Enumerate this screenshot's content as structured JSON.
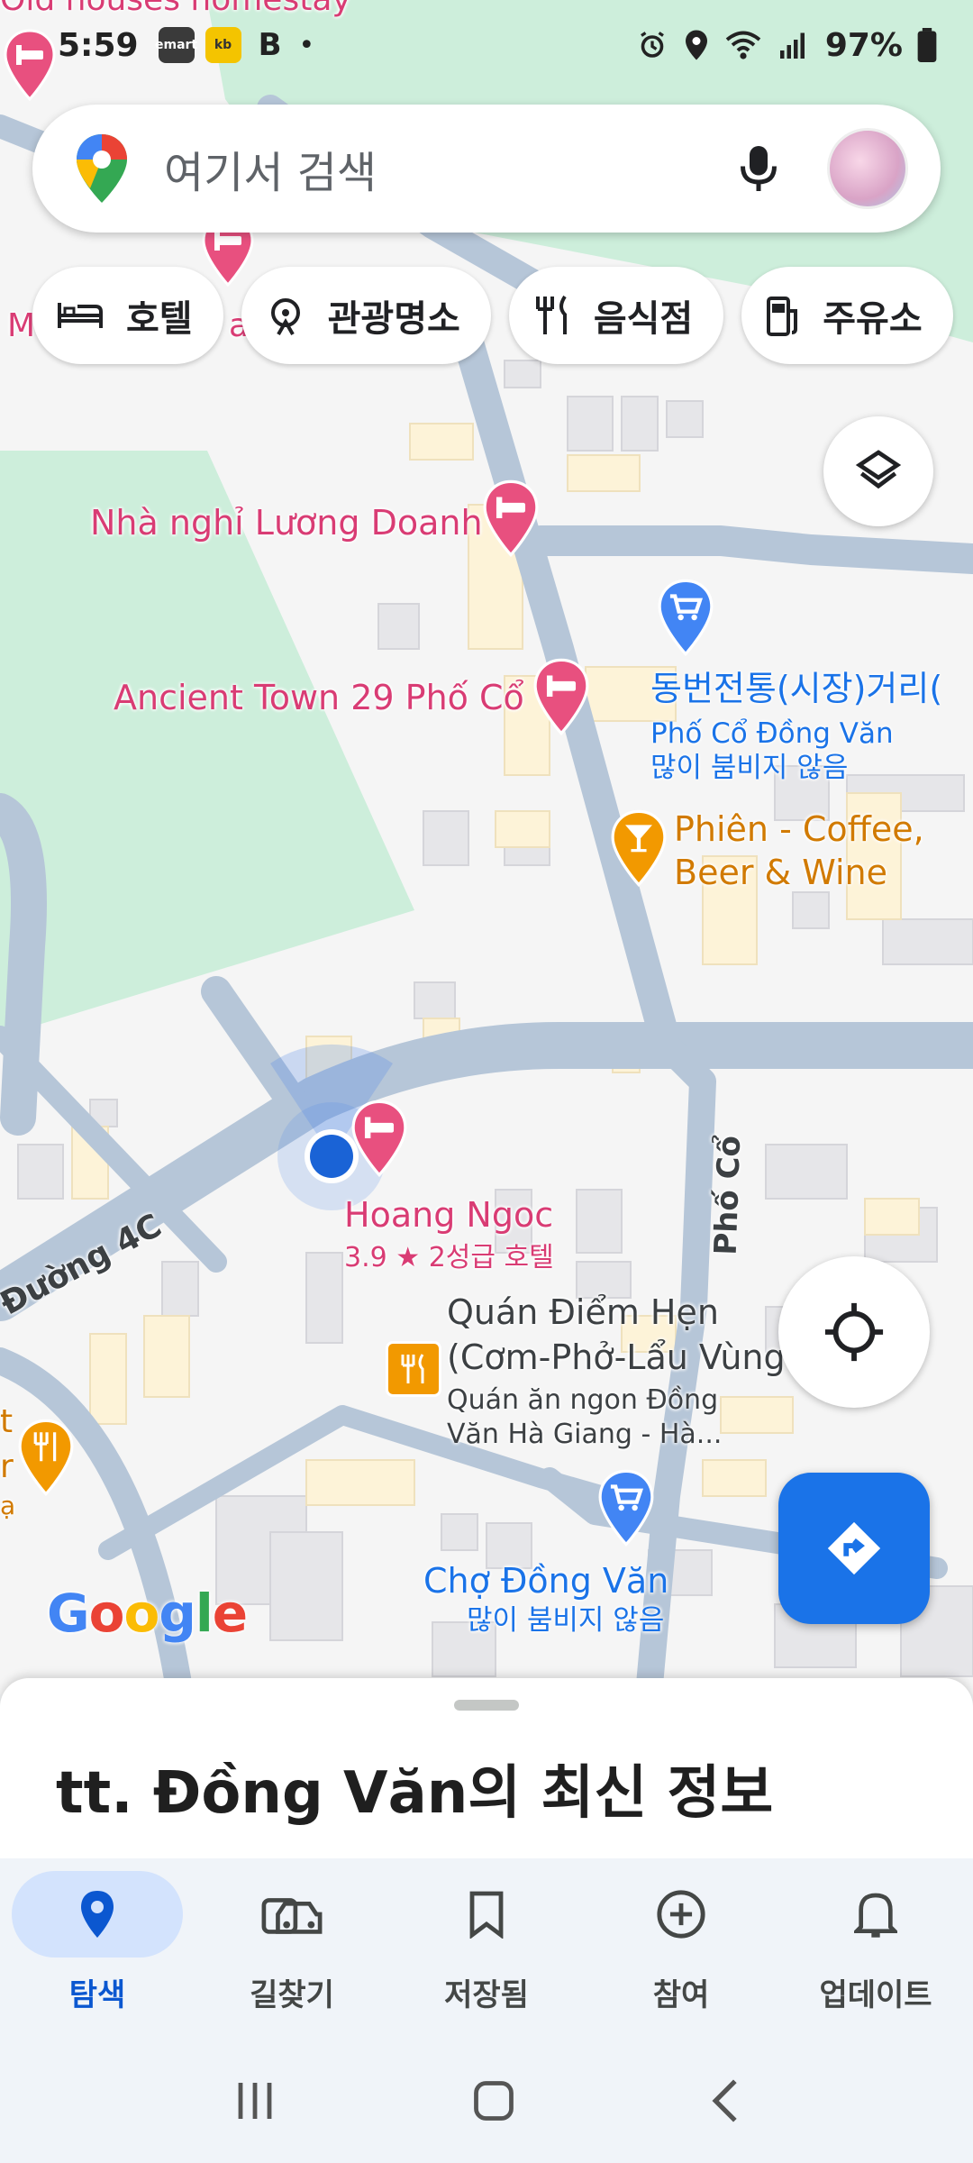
{
  "status": {
    "time": "5:59",
    "apps": [
      "emart",
      "kb",
      "B",
      "•"
    ],
    "battery": "97%"
  },
  "search": {
    "placeholder": "여기서 검색",
    "mic_icon": "mic-icon",
    "avatar": "profile-avatar"
  },
  "chips": [
    {
      "label": "호텔",
      "icon": "bed-icon"
    },
    {
      "label": "관광명소",
      "icon": "attraction-icon"
    },
    {
      "label": "음식점",
      "icon": "restaurant-icon"
    },
    {
      "label": "주유소",
      "icon": "gas-icon"
    }
  ],
  "map": {
    "labels": {
      "old_houses": "Old houses homestay",
      "partial_ma": "M",
      "partial_ay": "ay",
      "nha_nghi": "Nhà nghỉ Lương Doanh",
      "ancient_town": "Ancient Town 29 Phố Cổ",
      "market_street_title": "동번전통(시장)거리(",
      "market_street_sub1": "Phố Cổ Đồng Văn",
      "market_street_sub2": "많이 붐비지 않음",
      "phien_1": "Phiên - Coffee,",
      "phien_2": "Beer & Wine",
      "hoang_ngoc": "Hoang Ngoc",
      "hoang_ngoc_rating": "3.9",
      "hoang_ngoc_star": "★",
      "hoang_ngoc_class": "2성급 호텔",
      "quan_1": "Quán Điểm Hẹn",
      "quan_2": "(Cơm-Phở-Lẩu Vùng",
      "quan_sub1": "Quán ăn ngon Đồng",
      "quan_sub2": "Văn Hà Giang - Hà...",
      "cho_title": "Chợ Đồng Văn",
      "cho_sub": "많이 붐비지 않음",
      "road_4c": "Đường 4C",
      "road_pho_co": "Phố Cổ",
      "left_edge_t": "t",
      "left_edge_r": "r",
      "left_edge_o": "ạ"
    },
    "google_logo": [
      "G",
      "o",
      "o",
      "g",
      "l",
      "e"
    ],
    "google_colors": [
      "#4285F4",
      "#EA4335",
      "#FBBC05",
      "#4285F4",
      "#34A853",
      "#EA4335"
    ]
  },
  "sheet": {
    "title": "tt. Đồng Văn의 최신 정보"
  },
  "nav": [
    {
      "label": "탐색",
      "icon": "explore-pin-icon",
      "active": true
    },
    {
      "label": "길찾기",
      "icon": "commute-car-icon",
      "active": false
    },
    {
      "label": "저장됨",
      "icon": "bookmark-icon",
      "active": false
    },
    {
      "label": "참여",
      "icon": "contribute-plus-icon",
      "active": false
    },
    {
      "label": "업데이트",
      "icon": "bell-icon",
      "active": false
    }
  ],
  "colors": {
    "accent": "#1a73e8",
    "hotel_pin": "#e8507f",
    "shopping_pin": "#4285f4",
    "food_pin": "#f29900",
    "park": "#cdeedb",
    "road": "#b6c6d8"
  }
}
